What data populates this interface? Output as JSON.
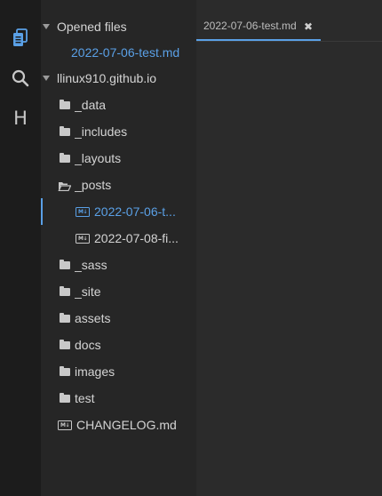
{
  "activity_bar": {
    "items": [
      {
        "name": "explorer",
        "icon": "files-icon"
      },
      {
        "name": "search",
        "icon": "search-icon"
      },
      {
        "name": "outline",
        "icon": "heading-icon",
        "glyph": "H"
      }
    ]
  },
  "sidebar": {
    "opened_files": {
      "header": "Opened files",
      "files": [
        "2022-07-06-test.md"
      ]
    },
    "project": {
      "name": "llinux910.github.io",
      "entries": [
        {
          "label": "_data",
          "kind": "folder"
        },
        {
          "label": "_includes",
          "kind": "folder"
        },
        {
          "label": "_layouts",
          "kind": "folder"
        },
        {
          "label": "_posts",
          "kind": "folder-open"
        },
        {
          "label": "2022-07-06-t...",
          "kind": "markdown"
        },
        {
          "label": "2022-07-08-fi...",
          "kind": "markdown"
        },
        {
          "label": "_sass",
          "kind": "folder"
        },
        {
          "label": "_site",
          "kind": "folder"
        },
        {
          "label": "assets",
          "kind": "folder"
        },
        {
          "label": "docs",
          "kind": "folder"
        },
        {
          "label": "images",
          "kind": "folder"
        },
        {
          "label": "test",
          "kind": "folder"
        },
        {
          "label": "CHANGELOG.md",
          "kind": "markdown"
        }
      ]
    }
  },
  "editor": {
    "tabs": [
      {
        "label": "2022-07-06-test.md",
        "close": "✖"
      }
    ]
  },
  "colors": {
    "accent": "#5aa0e6",
    "sidebar_bg": "#262626",
    "activity_bg": "#1c1c1c",
    "editor_bg": "#2b2b2b",
    "text": "#d4d4d4"
  }
}
